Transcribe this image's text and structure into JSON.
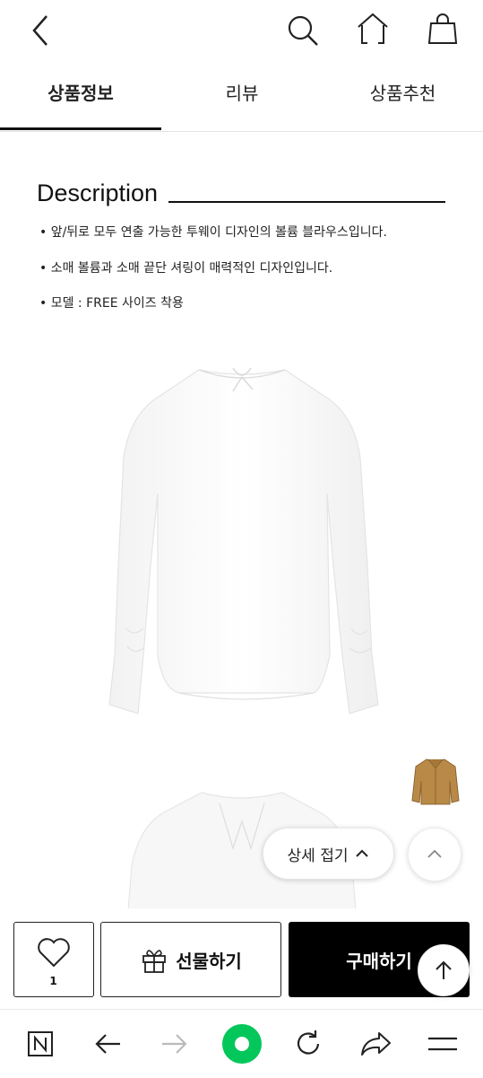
{
  "header": {
    "icons": [
      "back-arrow-icon",
      "search-icon",
      "home-icon",
      "shopping-bag-icon"
    ]
  },
  "tabs": [
    {
      "label": "상품정보",
      "active": true
    },
    {
      "label": "리뷰",
      "active": false
    },
    {
      "label": "상품추천",
      "active": false
    }
  ],
  "description": {
    "title": "Description",
    "bullets": [
      "• 앞/뒤로 모두 연출 가능한 투웨이 디자인의 볼륨 블라우스입니다.",
      "• 소매 볼륨과 소매 끝단 셔링이 매력적인 디자인입니다.",
      "• 모델  : FREE 사이즈 착용"
    ]
  },
  "floating": {
    "fold_label": "상세 접기",
    "recommend_thumbnail": "jacket-thumbnail"
  },
  "purchase": {
    "like_count": "1",
    "gift_label": "선물하기",
    "buy_label": "구매하기"
  },
  "browser": {
    "icons": [
      "naver-n-icon",
      "back-icon",
      "forward-icon",
      "green-home-dot-icon",
      "refresh-icon",
      "share-icon",
      "menu-icon"
    ],
    "accent": "#03c75a"
  }
}
